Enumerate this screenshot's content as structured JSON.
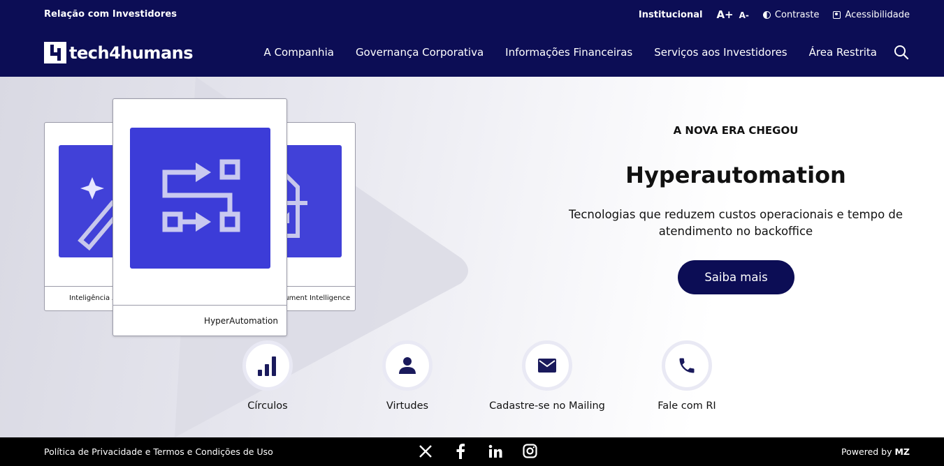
{
  "topbar": {
    "left": "Relação com Investidores",
    "institutional": "Institucional",
    "font_up": "A+",
    "font_down": "A-",
    "contrast": "Contraste",
    "accessibility": "Acessibilidade"
  },
  "brand": {
    "logo_text": "tech4humans"
  },
  "nav": [
    "A Companhia",
    "Governança Corporativa",
    "Informações Financeiras",
    "Serviços aos Investidores",
    "Área Restrita"
  ],
  "hero": {
    "eyebrow": "A NOVA ERA CHEGOU",
    "title": "Hyperautomation",
    "description": "Tecnologias que reduzem custos operacionais e tempo de atendimento no backoffice",
    "cta": "Saiba mais",
    "cards": {
      "left": "Inteligência Artificial",
      "main": "HyperAutomation",
      "right": "Document Intelligence"
    }
  },
  "quick_links": [
    {
      "label": "Círculos",
      "icon": "bar-chart-icon"
    },
    {
      "label": "Virtudes",
      "icon": "person-icon"
    },
    {
      "label": "Cadastre-se no Mailing",
      "icon": "envelope-icon"
    },
    {
      "label": "Fale com RI",
      "icon": "phone-icon"
    }
  ],
  "footer": {
    "left": "Política de Privacidade e Termos e Condições de Uso",
    "powered_by": "Powered by",
    "brand": "MZ",
    "social": [
      "x-icon",
      "facebook-icon",
      "linkedin-icon",
      "instagram-icon"
    ]
  },
  "colors": {
    "header_bg": "#0c0d55",
    "card_accent": "#4141d8",
    "footer_bg": "#000000"
  }
}
